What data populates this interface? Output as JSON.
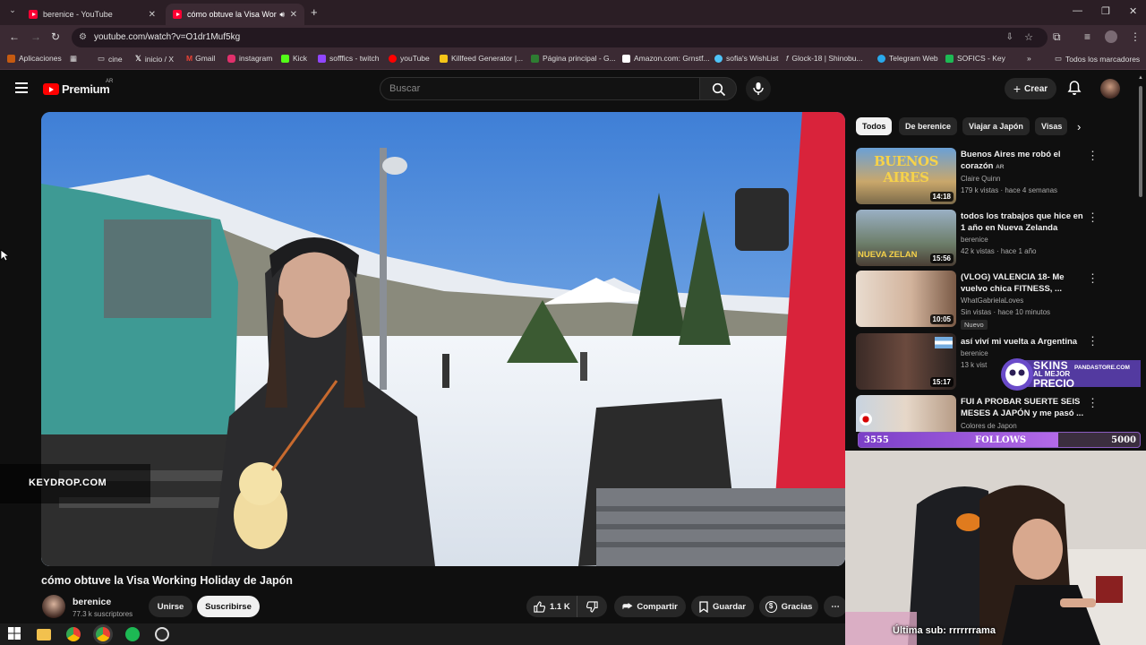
{
  "browser": {
    "tabs": [
      {
        "title": "berenice - YouTube",
        "active": false
      },
      {
        "title": "cómo obtuve la Visa Worki",
        "active": true
      }
    ],
    "new_tab": "+",
    "url": "youtube.com/watch?v=O1dr1Muf5kg",
    "bookmarks": [
      {
        "label": "Aplicaciones",
        "color": "#c55a11"
      },
      {
        "label": "cine",
        "color": "#888888"
      },
      {
        "label": "inicio / X",
        "color": "#ffffff"
      },
      {
        "label": "Gmail",
        "color": "#ea4335"
      },
      {
        "label": "instagram",
        "color": "#e1306c"
      },
      {
        "label": "Kick",
        "color": "#53fc18"
      },
      {
        "label": "sofffics - twitch",
        "color": "#9146ff"
      },
      {
        "label": "youTube",
        "color": "#ff0000"
      },
      {
        "label": "Killfeed Generator |...",
        "color": "#f5c518"
      },
      {
        "label": "Página principal - G...",
        "color": "#2e7d32"
      },
      {
        "label": "Amazon.com: Grnstf...",
        "color": "#ffffff"
      },
      {
        "label": "sofia's WishList",
        "color": "#4fc3f7"
      },
      {
        "label": "Glock-18 | Shinobu...",
        "color": "#9e9e9e"
      },
      {
        "label": "Telegram Web",
        "color": "#29a9eb"
      },
      {
        "label": "SOFICS - Key",
        "color": "#1db954"
      }
    ],
    "all_bookmarks": "Todos los marcadores"
  },
  "youtube": {
    "logo_text": "Premium",
    "logo_country": "AR",
    "search_placeholder": "Buscar",
    "create_label": "Crear"
  },
  "video": {
    "title": "cómo obtuve la Visa Working Holiday de Japón",
    "channel": "berenice",
    "subscribers": "77.3 k suscriptores",
    "join_label": "Unirse",
    "subscribe_label": "Suscribirse",
    "likes": "1.1 K",
    "share_label": "Compartir",
    "save_label": "Guardar",
    "thanks_label": "Gracias",
    "overlay_text": "KEYDROP.COM"
  },
  "chips": [
    "Todos",
    "De berenice",
    "Viajar a Japón",
    "Visas"
  ],
  "recommendations": [
    {
      "title": "Buenos Aires me robó el corazón",
      "badge": "AR",
      "channel": "Claire Quinn",
      "meta": "179 k vistas · hace 4 semanas",
      "duration": "14:18",
      "thumb_text": "BUENOS AIRES",
      "new": ""
    },
    {
      "title": "todos los trabajos que hice en 1 año en Nueva Zelanda",
      "badge": "",
      "channel": "berenice",
      "meta": "42 k vistas · hace 1 año",
      "duration": "15:56",
      "thumb_text": "NUEVA ZELAN",
      "new": ""
    },
    {
      "title": "(VLOG) VALENCIA 18- Me vuelvo chica FITNESS, ...",
      "badge": "",
      "channel": "WhatGabrielaLoves",
      "meta": "Sin vistas · hace 10 minutos",
      "duration": "10:05",
      "thumb_text": "",
      "new": "Nuevo"
    },
    {
      "title": "así viví mi vuelta a Argentina",
      "badge": "",
      "channel": "berenice",
      "meta": "13 k vist",
      "duration": "15:17",
      "thumb_text": "",
      "new": ""
    },
    {
      "title": "FUI A PROBAR SUERTE SEIS MESES A JAPÓN y me pasó ...",
      "badge": "",
      "channel": "Colores de Japon",
      "meta": "",
      "duration": "",
      "thumb_text": "",
      "new": ""
    }
  ],
  "stream_overlay": {
    "follows_current": "3555",
    "follows_label": "FOLLOWS",
    "follows_goal": "5000",
    "follows_progress": 0.711,
    "skins_line1": "SKINS",
    "skins_line2": "AL MEJOR",
    "skins_line3": "PRECIO",
    "skins_site": "PANDASTORE.COM",
    "cam_subtitle": "Última sub: rrrrrrrama"
  },
  "colors": {
    "yt_red": "#ff0000",
    "follows_purple": "#8a5cc0"
  }
}
